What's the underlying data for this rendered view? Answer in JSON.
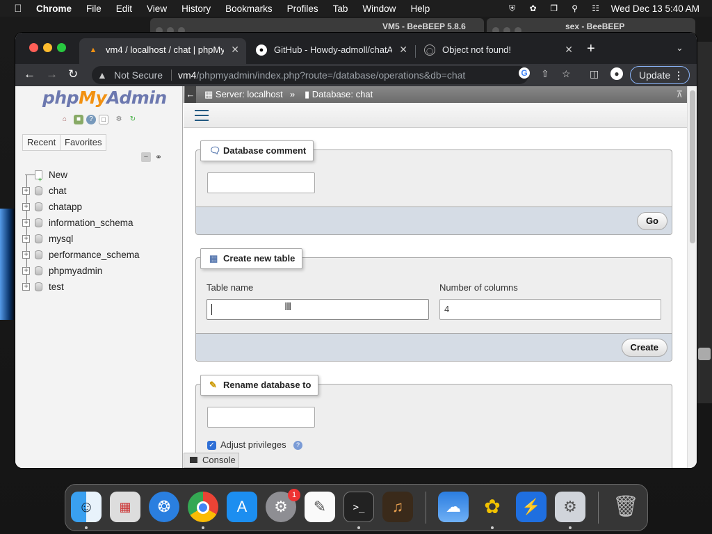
{
  "menubar": {
    "app": "Chrome",
    "items": [
      "File",
      "Edit",
      "View",
      "History",
      "Bookmarks",
      "Profiles",
      "Tab",
      "Window",
      "Help"
    ],
    "clock": "Wed Dec 13  5:40 AM"
  },
  "background_windows": {
    "left_title": "VM5 - BeeBEEP 5.8.6",
    "right_title": "sex - BeeBEEP"
  },
  "browser": {
    "tabs": [
      {
        "title": "vm4 / localhost / chat | phpMyA",
        "active": true
      },
      {
        "title": "GitHub - Howdy-admoll/chatAp",
        "active": false
      },
      {
        "title": "Object not found!",
        "active": false
      }
    ],
    "address": {
      "security": "Not Secure",
      "host": "vm4",
      "path": "/phpmyadmin/index.php?route=/database/operations&db=chat"
    },
    "update_label": "Update"
  },
  "sidebar": {
    "logo": {
      "php": "php",
      "my": "My",
      "admin": "Admin"
    },
    "recent": "Recent",
    "favorites": "Favorites",
    "tree": [
      "New",
      "chat",
      "chatapp",
      "information_schema",
      "mysql",
      "performance_schema",
      "phpmyadmin",
      "test"
    ]
  },
  "breadcrumb": {
    "server": "Server: localhost",
    "separator": "»",
    "database": "Database: chat"
  },
  "db_comment": {
    "legend": "Database comment",
    "value": "",
    "go": "Go"
  },
  "create_table": {
    "legend": "Create new table",
    "table_name_label": "Table name",
    "table_name_value": "",
    "columns_label": "Number of columns",
    "columns_value": "4",
    "create": "Create"
  },
  "rename_db": {
    "legend": "Rename database to",
    "value": "",
    "adjust_privileges": "Adjust privileges"
  },
  "console": "Console",
  "dock": {
    "apps": [
      "Finder",
      "Launchpad",
      "Safari",
      "Google Chrome",
      "App Store",
      "System Settings",
      "TextEdit",
      "Terminal",
      "GarageBand",
      "Weather",
      "BeeBEEP",
      "Shield",
      "Settings",
      "Trash"
    ],
    "system_settings_badge": "1"
  }
}
